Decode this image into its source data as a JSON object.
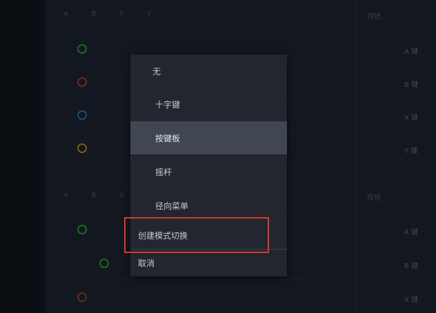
{
  "background": {
    "section1_header": "A · B · X · Y",
    "section1_colhead": "按钮",
    "section2_header": "A · B · X · Y",
    "section2_colhead": "按钮",
    "values": [
      "A 键",
      "B 键",
      "X 键",
      "Y 键",
      "A 键",
      "B 键",
      "X 键"
    ]
  },
  "menu": {
    "items": [
      {
        "label": "无",
        "selected": false
      },
      {
        "label": "十字键",
        "selected": false
      },
      {
        "label": "按键板",
        "selected": true
      },
      {
        "label": "摇杆",
        "selected": false
      },
      {
        "label": "径向菜单",
        "selected": false
      },
      {
        "label": "创建模式切换",
        "selected": false
      },
      {
        "label": "取消",
        "selected": false
      }
    ]
  },
  "colors": {
    "menu_bg": "#23262e",
    "selected_bg": "#414752",
    "highlight_border": "#e0382e",
    "button_green": "#1f7a1f",
    "button_red": "#7a2a1a",
    "button_blue": "#1a4f7a",
    "button_yellow": "#8a6d10"
  }
}
